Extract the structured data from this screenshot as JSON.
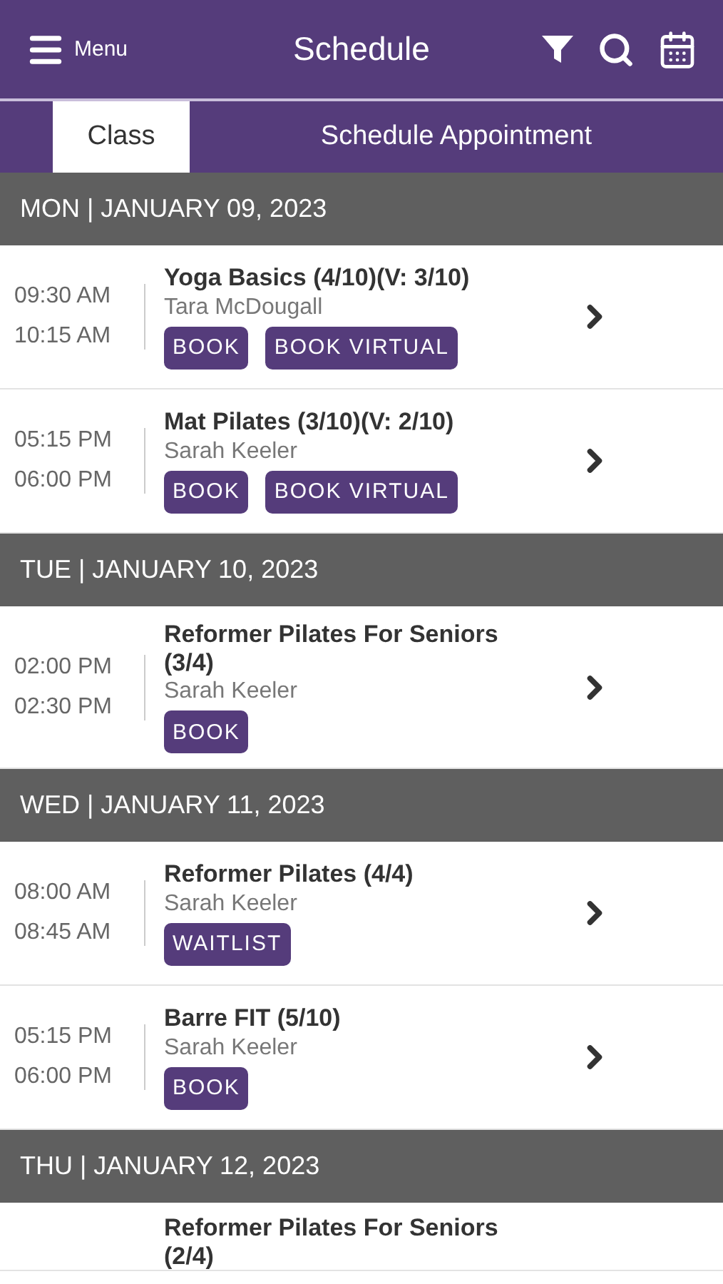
{
  "header": {
    "menu_label": "Menu",
    "title": "Schedule"
  },
  "tabs": [
    {
      "label": "Class",
      "selected": true
    },
    {
      "label": "Schedule Appointment",
      "selected": false
    }
  ],
  "days": [
    {
      "date": "MON | JANUARY 09, 2023",
      "sessions": [
        {
          "start": "09:30 AM",
          "end": "10:15 AM",
          "title": "Yoga Basics (4/10)(V: 3/10)",
          "instructor": "Tara McDougall",
          "buttons": [
            "BOOK",
            "BOOK VIRTUAL"
          ]
        },
        {
          "start": "05:15 PM",
          "end": "06:00 PM",
          "title": "Mat Pilates (3/10)(V: 2/10)",
          "instructor": "Sarah Keeler",
          "buttons": [
            "BOOK",
            "BOOK VIRTUAL"
          ]
        }
      ]
    },
    {
      "date": "TUE | JANUARY 10, 2023",
      "sessions": [
        {
          "start": "02:00 PM",
          "end": "02:30 PM",
          "title": "Reformer Pilates For Seniors (3/4)",
          "instructor": "Sarah Keeler",
          "buttons": [
            "BOOK"
          ]
        }
      ]
    },
    {
      "date": "WED | JANUARY 11, 2023",
      "sessions": [
        {
          "start": "08:00 AM",
          "end": "08:45 AM",
          "title": "Reformer Pilates (4/4)",
          "instructor": "Sarah Keeler",
          "buttons": [
            "WAITLIST"
          ]
        },
        {
          "start": "05:15 PM",
          "end": "06:00 PM",
          "title": "Barre FIT (5/10)",
          "instructor": "Sarah Keeler",
          "buttons": [
            "BOOK"
          ]
        }
      ]
    },
    {
      "date": "THU | JANUARY 12, 2023",
      "sessions": [
        {
          "title": "Reformer Pilates For Seniors (2/4)"
        }
      ]
    }
  ]
}
